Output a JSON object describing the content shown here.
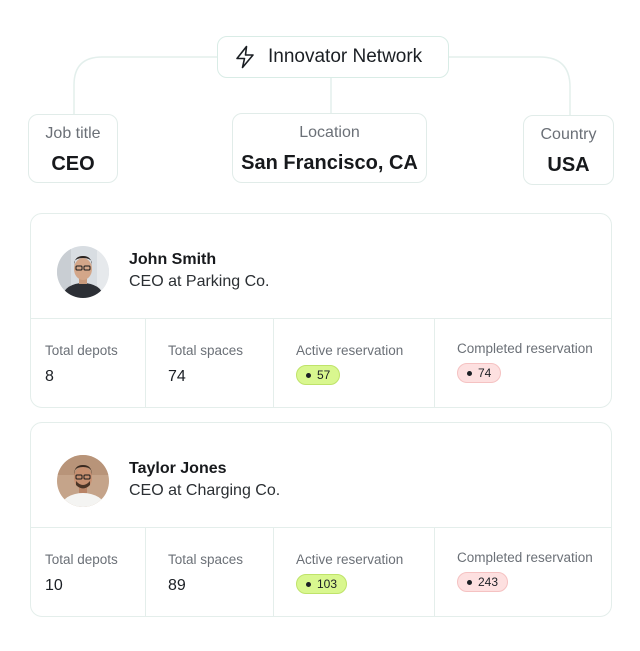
{
  "network": {
    "title": "Innovator Network",
    "icon": "lightning-icon",
    "accent": "#d9ece6"
  },
  "tags": {
    "job": {
      "label": "Job title",
      "value": "CEO"
    },
    "location": {
      "label": "Location",
      "value": "San Francisco, CA"
    },
    "country": {
      "label": "Country",
      "value": "USA"
    }
  },
  "people": [
    {
      "name": "John Smith",
      "role": "CEO at Parking Co.",
      "stats": {
        "depots_label": "Total depots",
        "depots": "8",
        "spaces_label": "Total spaces",
        "spaces": "74",
        "active_label": "Active reservation",
        "active": "57",
        "completed_label": "Completed reservation",
        "completed": "74"
      }
    },
    {
      "name": "Taylor Jones",
      "role": "CEO at Charging Co.",
      "stats": {
        "depots_label": "Total depots",
        "depots": "10",
        "spaces_label": "Total spaces",
        "spaces": "89",
        "active_label": "Active reservation",
        "active": "103",
        "completed_label": "Completed reservation",
        "completed": "243"
      }
    }
  ],
  "colors": {
    "active_pill": "#d9f78f",
    "completed_pill": "#fde0e0",
    "border": "#e4eeeb"
  }
}
